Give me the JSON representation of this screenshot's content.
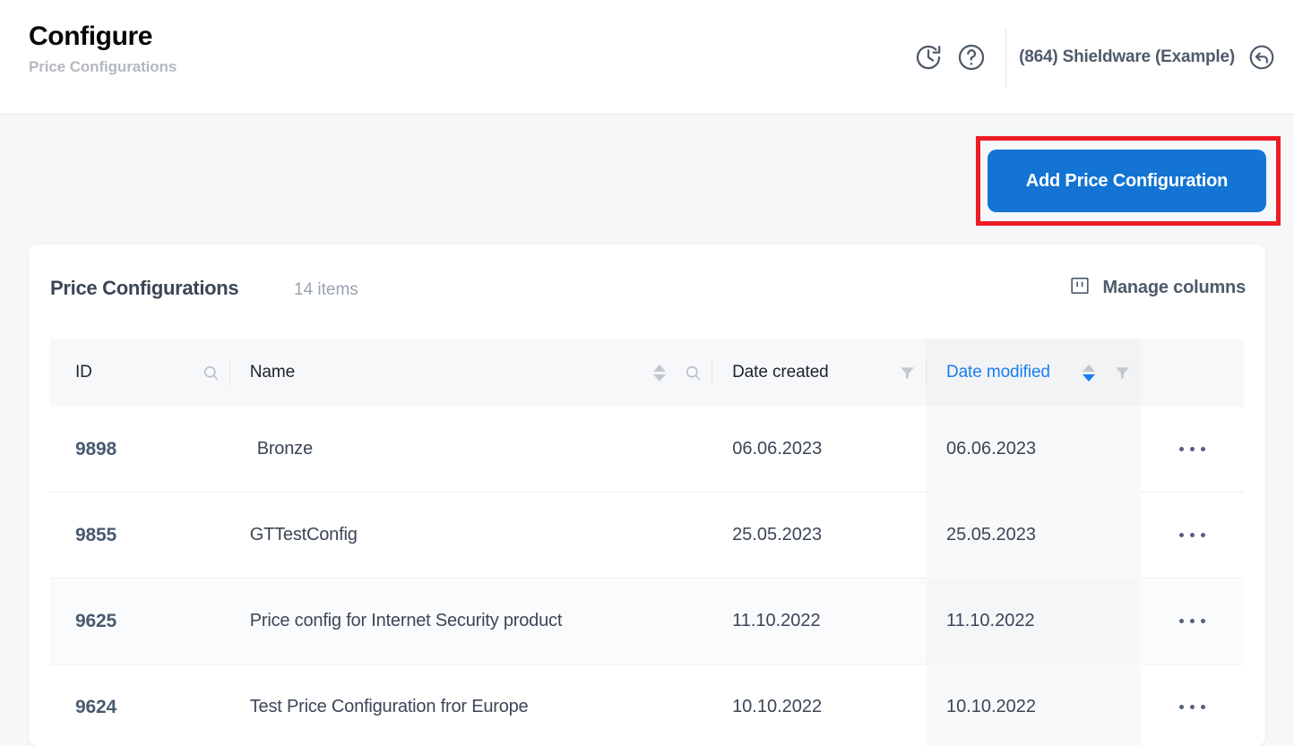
{
  "header": {
    "title": "Configure",
    "subtitle": "Price Configurations",
    "history_icon": "history-clock-icon",
    "help_icon": "help-question-icon",
    "company": "(864) Shieldware (Example)",
    "back_icon": "back-arrow-icon"
  },
  "toolbar": {
    "add_button_label": "Add Price Configuration",
    "highlight_color": "#ed1c24",
    "accent_color": "#1374d4"
  },
  "card": {
    "title": "Price Configurations",
    "count_label": "14 items",
    "manage_columns_label": "Manage columns",
    "manage_columns_icon": "columns-icon"
  },
  "table": {
    "columns": [
      {
        "key": "id",
        "label": "ID",
        "sortable": false,
        "searchable": true,
        "filterable": false,
        "active": false
      },
      {
        "key": "name",
        "label": "Name",
        "sortable": true,
        "searchable": true,
        "filterable": false,
        "active": false
      },
      {
        "key": "dc",
        "label": "Date created",
        "sortable": false,
        "searchable": false,
        "filterable": true,
        "active": false
      },
      {
        "key": "dm",
        "label": "Date modified",
        "sortable": true,
        "searchable": false,
        "filterable": true,
        "active": true,
        "sort_direction": "desc"
      }
    ],
    "rows": [
      {
        "id": "9898",
        "name": "Bronze",
        "date_created": "06.06.2023",
        "date_modified": "06.06.2023",
        "indent": true
      },
      {
        "id": "9855",
        "name": "GTTestConfig",
        "date_created": "25.05.2023",
        "date_modified": "25.05.2023",
        "indent": false
      },
      {
        "id": "9625",
        "name": "Price config for Internet Security product",
        "date_created": "11.10.2022",
        "date_modified": "11.10.2022",
        "indent": false
      },
      {
        "id": "9624",
        "name": "Test Price Configuration fror Europe",
        "date_created": "10.10.2022",
        "date_modified": "10.10.2022",
        "indent": false
      }
    ],
    "row_action_icon": "ellipsis-menu-icon",
    "search_icon": "search-icon",
    "filter_icon": "filter-funnel-icon",
    "sort_icon": "sort-arrows-icon"
  }
}
